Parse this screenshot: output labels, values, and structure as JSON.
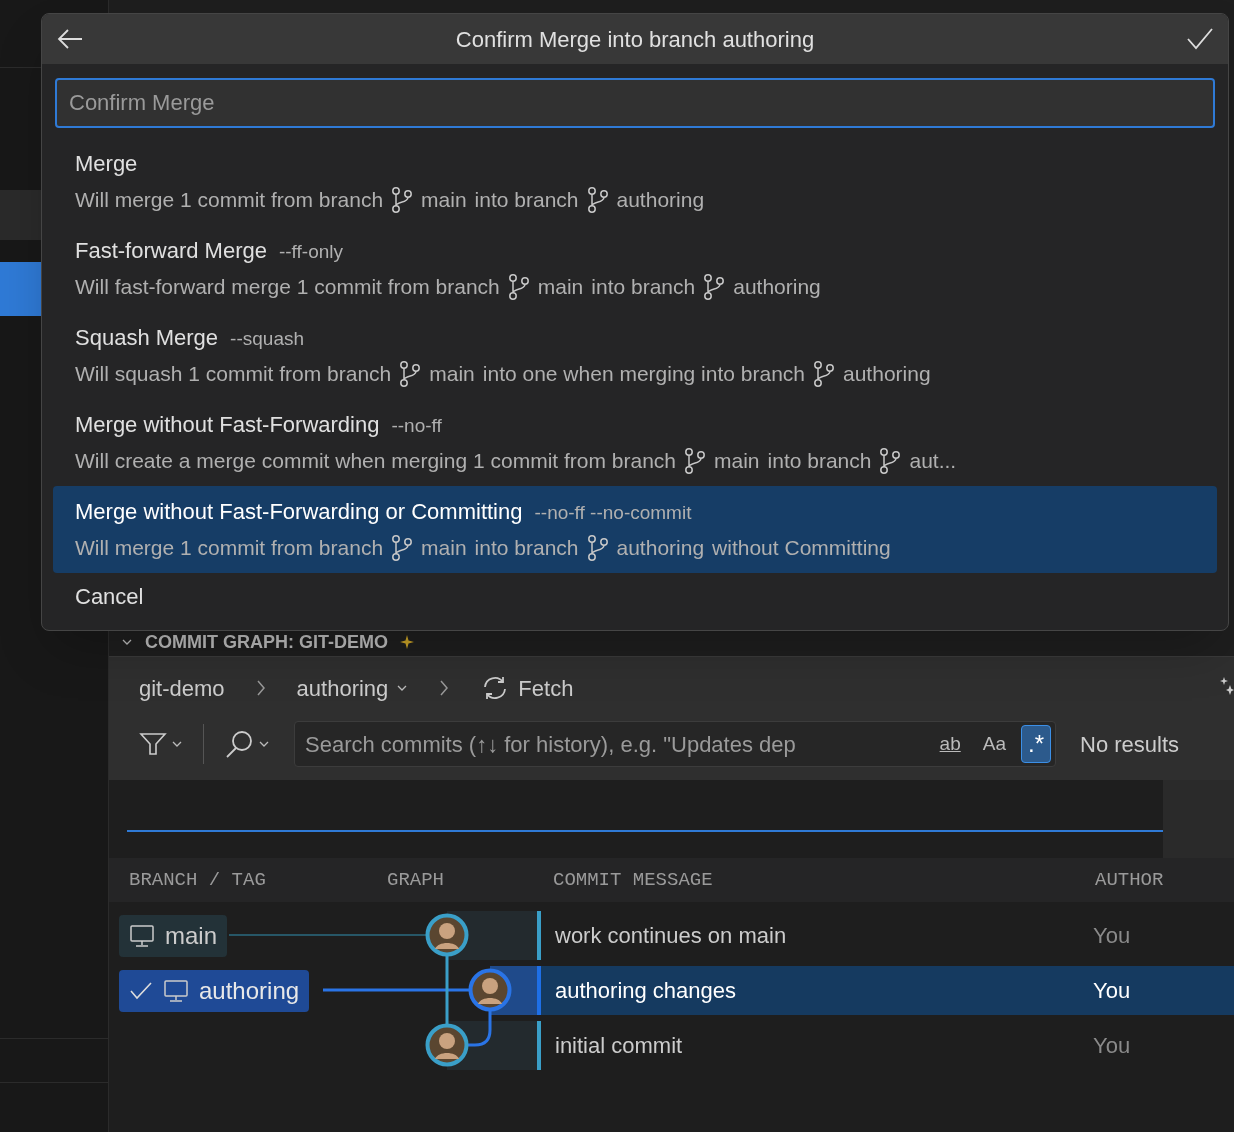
{
  "dialog": {
    "title": "Confirm Merge into branch authoring",
    "input": {
      "placeholder": "Confirm Merge"
    },
    "options": [
      {
        "label": "Merge",
        "selected": false,
        "description": [
          {
            "kind": "text",
            "text": "Will merge 1 commit from branch"
          },
          {
            "kind": "branch",
            "text": "main"
          },
          {
            "kind": "text",
            "text": "into branch"
          },
          {
            "kind": "branch",
            "text": "authoring"
          }
        ]
      },
      {
        "label": "Fast-forward Merge",
        "flag": "--ff-only",
        "selected": false,
        "description": [
          {
            "kind": "text",
            "text": "Will fast-forward merge 1 commit from branch"
          },
          {
            "kind": "branch",
            "text": "main"
          },
          {
            "kind": "text",
            "text": "into branch"
          },
          {
            "kind": "branch",
            "text": "authoring"
          }
        ]
      },
      {
        "label": "Squash Merge",
        "flag": "--squash",
        "selected": false,
        "description": [
          {
            "kind": "text",
            "text": "Will squash 1 commit from branch"
          },
          {
            "kind": "branch",
            "text": "main"
          },
          {
            "kind": "text",
            "text": "into one when merging into branch"
          },
          {
            "kind": "branch",
            "text": "authoring"
          }
        ]
      },
      {
        "label": "Merge without Fast-Forwarding",
        "flag": "--no-ff",
        "selected": false,
        "description": [
          {
            "kind": "text",
            "text": "Will create a merge commit when merging 1 commit from branch"
          },
          {
            "kind": "branch",
            "text": "main"
          },
          {
            "kind": "text",
            "text": "into branch"
          },
          {
            "kind": "branch",
            "text": "aut..."
          }
        ]
      },
      {
        "label": "Merge without Fast-Forwarding or Committing",
        "flag": "--no-ff --no-commit",
        "selected": true,
        "description": [
          {
            "kind": "text",
            "text": "Will merge 1 commit from branch"
          },
          {
            "kind": "branch",
            "text": "main"
          },
          {
            "kind": "text",
            "text": "into branch"
          },
          {
            "kind": "branch",
            "text": "authoring"
          },
          {
            "kind": "text",
            "text": "without Committing"
          }
        ]
      },
      {
        "label": "Cancel",
        "selected": false
      }
    ]
  },
  "panel": {
    "title": "COMMIT GRAPH: GIT-DEMO",
    "repo": "git-demo",
    "branch": "authoring",
    "fetch": "Fetch",
    "search": {
      "placeholder": "Search commits (↑↓ for history), e.g. \"Updates dep",
      "toggles": [
        {
          "label": "ab",
          "on": false
        },
        {
          "label": "Aa",
          "on": false
        },
        {
          "label": ".*",
          "on": true
        }
      ]
    },
    "result": "No results",
    "columns": [
      "BRANCH / TAG",
      "GRAPH",
      "COMMIT MESSAGE",
      "AUTHOR"
    ],
    "rows": [
      {
        "branch": {
          "name": "main",
          "current": false
        },
        "message": "work continues on main",
        "author": "You",
        "selected": false
      },
      {
        "branch": {
          "name": "authoring",
          "current": true
        },
        "message": "authoring changes",
        "author": "You",
        "selected": true
      },
      {
        "message": "initial commit",
        "author": "You",
        "selected": false
      }
    ]
  }
}
